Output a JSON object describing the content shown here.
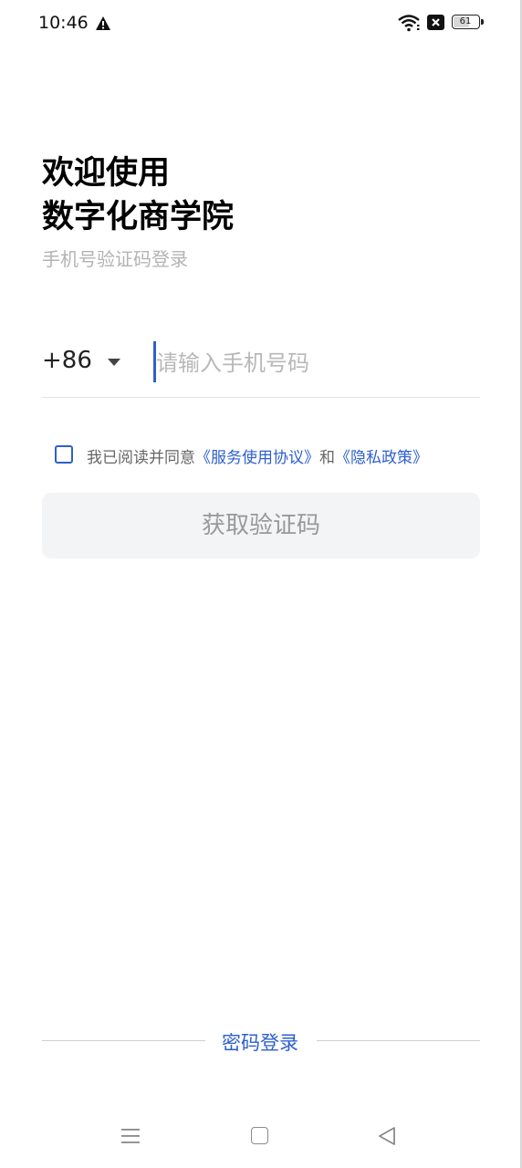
{
  "status_bar": {
    "time": "10:46",
    "battery_level": "61",
    "icons": [
      "warning-icon",
      "wifi-icon",
      "no-sim-icon",
      "battery-icon"
    ]
  },
  "header": {
    "title_line1": "欢迎使用",
    "title_line2": "数字化商学院",
    "subtitle": "手机号验证码登录"
  },
  "form": {
    "country_code": "+86",
    "phone_placeholder": "请输入手机号码",
    "phone_value": "",
    "agreement": {
      "prefix": "我已阅读并同意",
      "service_link": "《服务使用协议》",
      "and": "和",
      "privacy_link": "《隐私政策》",
      "checked": false
    },
    "get_code_button": "获取验证码"
  },
  "footer": {
    "password_login": "密码登录"
  },
  "colors": {
    "accent": "#2d5fce",
    "button_bg": "#f3f4f6",
    "button_text": "#999999",
    "placeholder": "#b8b8b8",
    "subtitle": "#b3b3b3"
  },
  "nav_bar": {
    "icons": [
      "menu-icon",
      "home-icon",
      "back-icon"
    ]
  }
}
